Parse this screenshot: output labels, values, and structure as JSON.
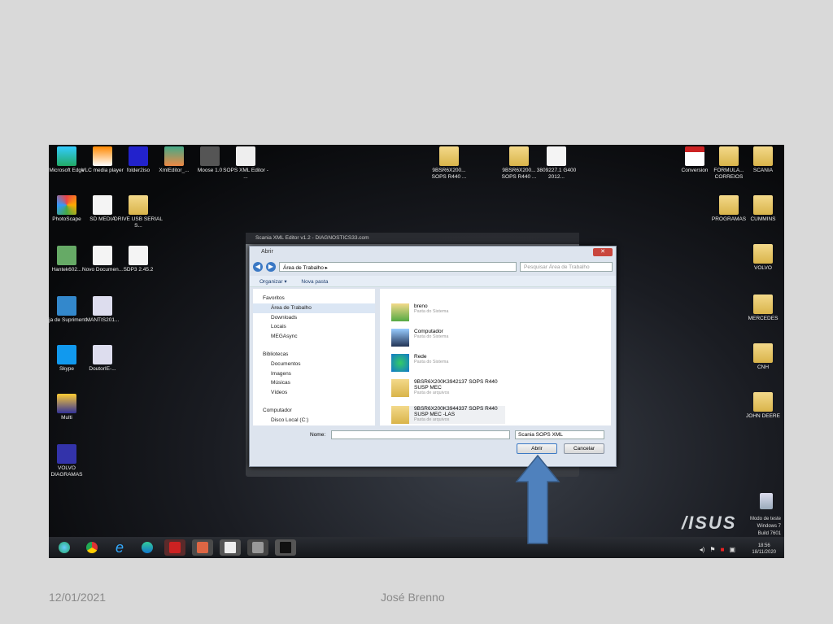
{
  "desktop_icons_left": [
    {
      "label": "Microsoft Edge"
    },
    {
      "label": "VLC media player"
    },
    {
      "label": "folder2iso"
    },
    {
      "label": "XmlEditor_..."
    },
    {
      "label": "Moose 1.0"
    },
    {
      "label": "SOPS XML Editor - ..."
    },
    {
      "label": "PhotoScape"
    },
    {
      "label": "SD MEDIA"
    },
    {
      "label": "DRIVE USB SERIAL S..."
    },
    {
      "label": "Hantek602..."
    },
    {
      "label": "Novo Documen..."
    },
    {
      "label": "SDP3 2.45.2"
    },
    {
      "label": "Loja de Supriment..."
    },
    {
      "label": "MANTIS201..."
    },
    {
      "label": "Skype"
    },
    {
      "label": "DoutorIE-..."
    },
    {
      "label": "Multi"
    },
    {
      "label": "VOLVO DIAGRAMAS"
    }
  ],
  "desktop_icons_center": [
    {
      "label": "9BSR6X200... SOPS R440 ..."
    },
    {
      "label": "9BSR6X200... SOPS R440 ..."
    },
    {
      "label": "3809227.1 G400 2012..."
    }
  ],
  "desktop_icons_right": [
    {
      "label": "Conversion"
    },
    {
      "label": "FORMULA... CORREIOS"
    },
    {
      "label": "SCANIA"
    },
    {
      "label": "PROGRAMAS"
    },
    {
      "label": "CUMMINS"
    },
    {
      "label": "VOLVO"
    },
    {
      "label": "MERCEDES"
    },
    {
      "label": "CNH"
    },
    {
      "label": "JOHN DEERE"
    },
    {
      "label": "Lixeira"
    }
  ],
  "bg_window_title": "Scania XML Editor v1.2 - DIAGNOSTICS33.com",
  "dialog": {
    "title": "Abrir",
    "close": "✕",
    "path": "Área de Trabalho ▸",
    "search_placeholder": "Pesquisar Área de Trabalho",
    "toolbar": {
      "organize": "Organizar ▾",
      "new_folder": "Nova pasta"
    },
    "nav": [
      {
        "label": "Favoritos"
      },
      {
        "label": "Área de Trabalho"
      },
      {
        "label": "Downloads"
      },
      {
        "label": "Locais"
      },
      {
        "label": "MEGAsync"
      },
      {
        "label": "Bibliotecas"
      },
      {
        "label": "Documentos"
      },
      {
        "label": "Imagens"
      },
      {
        "label": "Músicas"
      },
      {
        "label": "Vídeos"
      },
      {
        "label": "Computador"
      },
      {
        "label": "Disco Local (C:)"
      }
    ],
    "files": [
      {
        "name": "breno",
        "type": "Pasta do Sistema"
      },
      {
        "name": "Computador",
        "type": "Pasta do Sistema"
      },
      {
        "name": "Rede",
        "type": "Pasta do Sistema"
      },
      {
        "name": "9BSR6X200K3942137 SOPS R440 SUSP MEC",
        "type": "Pasta de arquivos"
      },
      {
        "name": "9BSR6X200K3944337 SOPS R440 SUSP MEC -LAS",
        "type": "Pasta de arquivos"
      }
    ],
    "name_label": "Nome:",
    "name_value": "",
    "filter": "Scania SOPS XML",
    "open": "Abrir",
    "cancel": "Cancelar"
  },
  "asus": "/ISUS",
  "windows_info": "Modo de teste Windows 7 Build 7601",
  "clock": {
    "time": "18:56",
    "date": "18/11/2020"
  },
  "footer": {
    "date": "12/01/2021",
    "author": "José Brenno"
  },
  "arrow_color": "#4f81bd"
}
